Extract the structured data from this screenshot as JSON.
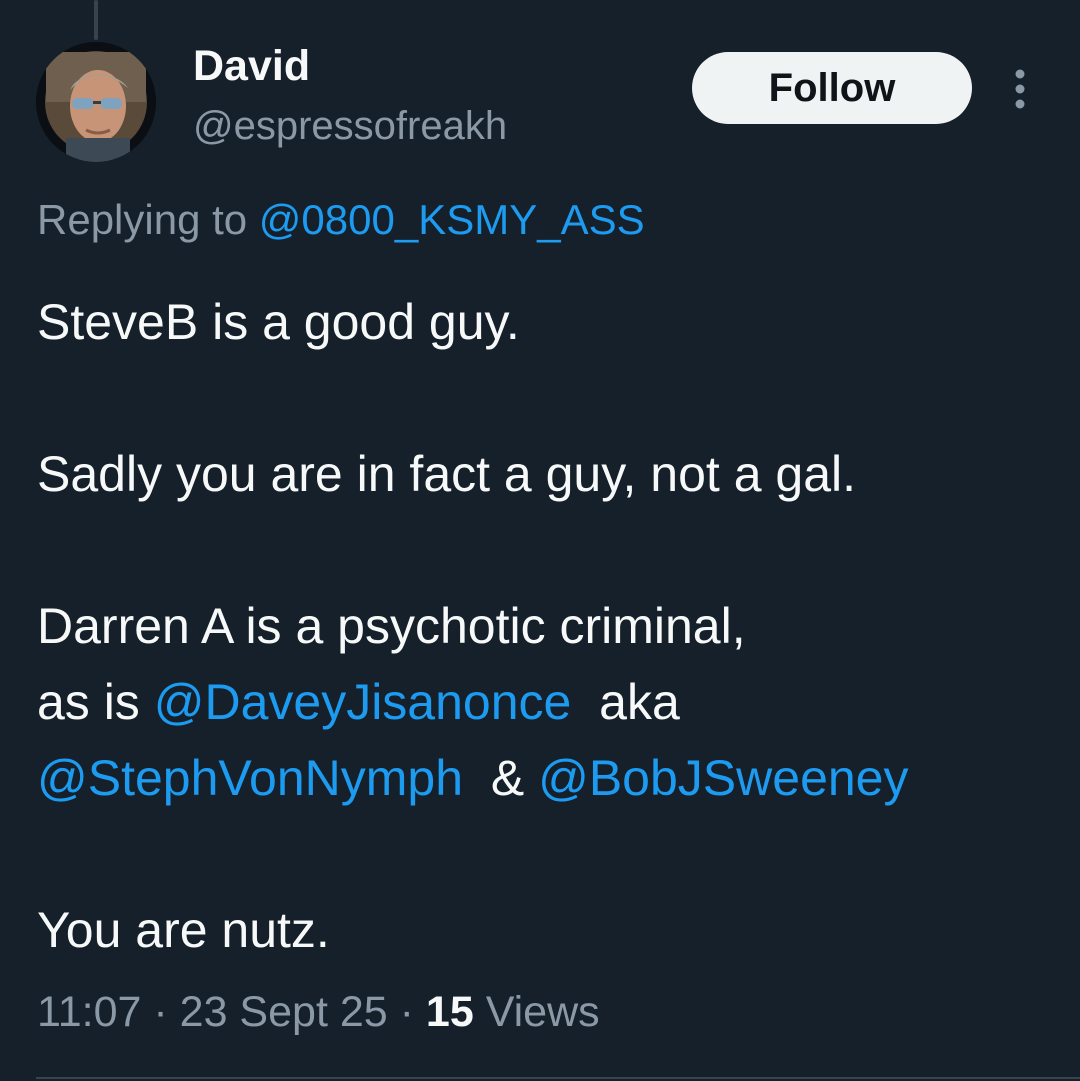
{
  "author": {
    "display_name": "David",
    "handle": "@espressofreakh",
    "avatar_icon": "avatar-photo"
  },
  "actions": {
    "follow_label": "Follow",
    "more_icon": "more-vertical-icon"
  },
  "reply": {
    "prefix": "Replying to",
    "mention": "@0800_KSMY_ASS"
  },
  "tweet": {
    "line1": "SteveB is a good guy.",
    "line2": "Sadly you are in fact a guy, not a gal.",
    "line3": "Darren A is a psychotic criminal,",
    "line4_prefix": "as is",
    "mention_1": "@DaveyJisanonce",
    "line4_suffix": "aka",
    "mention_2": "@StephVonNymph",
    "ampersand": "&",
    "mention_3": "@BobJSweeney",
    "line5": "You are nutz."
  },
  "meta": {
    "time": "11:07",
    "separator": "·",
    "date": "23 Sept 25",
    "views_count": "15",
    "views_label": "Views"
  },
  "colors": {
    "background": "#15202b",
    "text": "#f7f9f9",
    "secondary": "#8b98a5",
    "link": "#1d9bf0",
    "follow_button_bg": "#eff3f4"
  }
}
